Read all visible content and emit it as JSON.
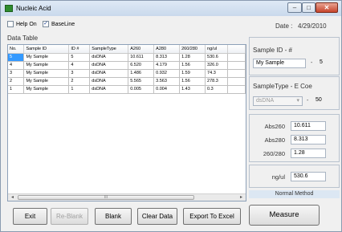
{
  "window": {
    "title": "Nucleic Acid",
    "controls": {
      "minimize": "–",
      "maximize": "□",
      "close": "✕"
    }
  },
  "options": {
    "help_on": {
      "label": "Help On",
      "checked": false
    },
    "baseline": {
      "label": "BaseLine",
      "checked": true
    },
    "date_label": "Date :",
    "date_value": "4/29/2010"
  },
  "data_table": {
    "title": "Data Table",
    "columns": [
      "No.",
      "Sample ID",
      "ID #",
      "SampleType",
      "A260",
      "A280",
      "260/280",
      "ng/ul"
    ],
    "rows": [
      [
        "5",
        "My Sample",
        "5",
        "dsDNA",
        "10.611",
        "8.313",
        "1.28",
        "530.6"
      ],
      [
        "4",
        "My Sample",
        "4",
        "dsDNA",
        "6.520",
        "4.179",
        "1.56",
        "326.0"
      ],
      [
        "3",
        "My Sample",
        "3",
        "dsDNA",
        "1.486",
        "0.932",
        "1.59",
        "74.3"
      ],
      [
        "2",
        "My Sample",
        "2",
        "dsDNA",
        "5.565",
        "3.563",
        "1.56",
        "278.3"
      ],
      [
        "1",
        "My Sample",
        "1",
        "dsDNA",
        "0.005",
        "0.004",
        "1.43",
        "0.3"
      ]
    ],
    "selected_row": 0,
    "scroll": {
      "left_arrow": "◂",
      "right_arrow": "▸",
      "thumb_grip": "III"
    }
  },
  "sample_id": {
    "label": "Sample ID - #",
    "name_value": "My Sample",
    "separator": "-",
    "number_value": "5"
  },
  "sample_type": {
    "label": "SampleType - E Coe",
    "selected": "dsDNA",
    "dropdown_arrow": "▾",
    "separator": "-",
    "coefficient": "50"
  },
  "readings": {
    "abs260_label": "Abs260",
    "abs260_value": "10.611",
    "abs280_label": "Abs280",
    "abs280_value": "8.313",
    "ratio_label": "260/280",
    "ratio_value": "1.28"
  },
  "concentration": {
    "label": "ng/ul",
    "value": "530.6"
  },
  "method": "Normal Method",
  "buttons": {
    "exit": "Exit",
    "reblank": "Re-Blank",
    "blank": "Blank",
    "clear_data": "Clear Data",
    "export": "Export To Excel",
    "measure": "Measure"
  },
  "colors": {
    "selection": "#3399ff",
    "title_bar": "#c9d9ec",
    "close_button": "#c7442b",
    "method_bar": "#dce7f3"
  }
}
